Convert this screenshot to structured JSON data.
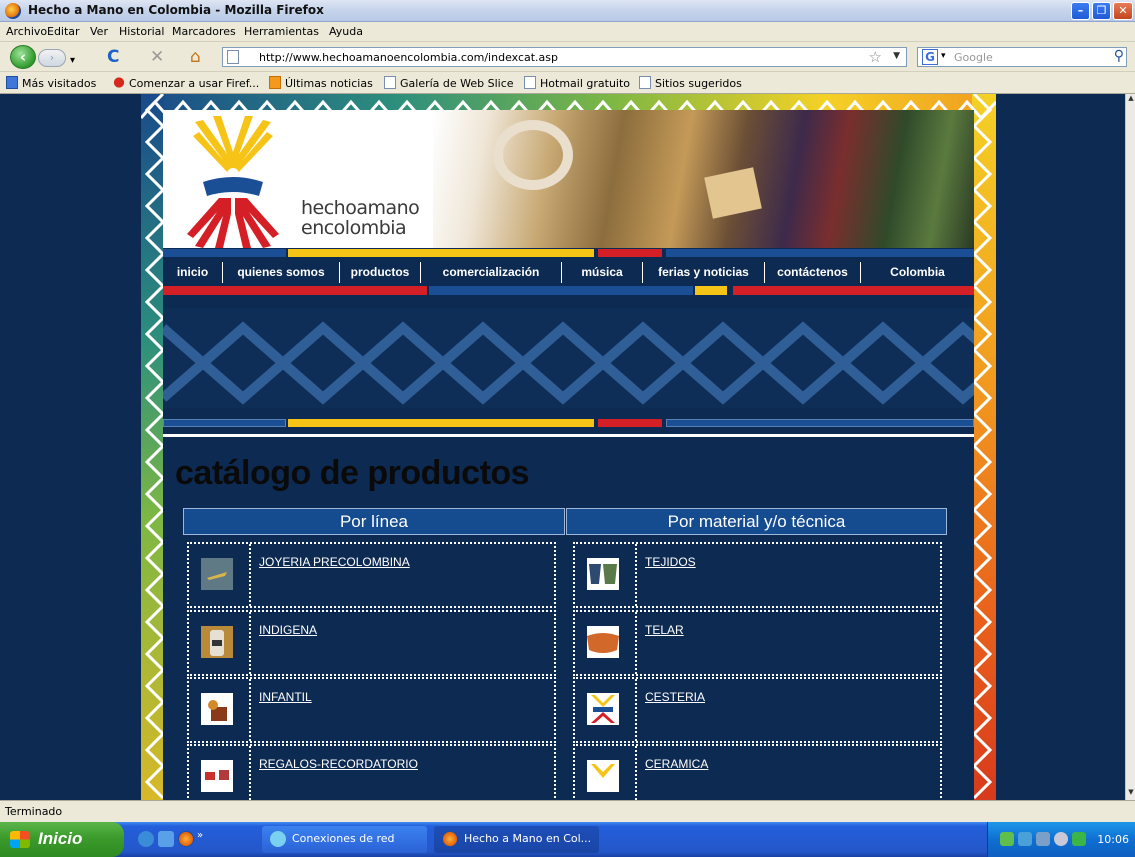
{
  "window": {
    "title": "Hecho a Mano en Colombia - Mozilla Firefox"
  },
  "menu": [
    "Archivo",
    "Editar",
    "Ver",
    "Historial",
    "Marcadores",
    "Herramientas",
    "Ayuda"
  ],
  "address": {
    "url": "http://www.hechoamanoencolombia.com/indexcat.asp"
  },
  "search": {
    "placeholder": "Google"
  },
  "bookmarks": [
    "Más visitados",
    "Comenzar a usar Firef...",
    "Últimas noticias",
    "Galería de Web Slice",
    "Hotmail gratuito",
    "Sitios sugeridos"
  ],
  "site": {
    "brand_line1": "hechoamano",
    "brand_line2": "encolombia",
    "nav": [
      "inicio",
      "quienes somos",
      "productos",
      "comercialización",
      "música",
      "ferias y noticias",
      "contáctenos",
      "Colombia"
    ],
    "page_title": "catálogo de productos",
    "catalog": {
      "col_left_header": "Por línea",
      "col_right_header": "Por material y/o técnica",
      "left": [
        "JOYERIA PRECOLOMBINA",
        "INDIGENA",
        "INFANTIL",
        "REGALOS-RECORDATORIO"
      ],
      "right": [
        "TEJIDOS",
        "TELAR",
        "CESTERIA",
        "CERAMICA"
      ]
    }
  },
  "status": {
    "text": "Terminado"
  },
  "taskbar": {
    "start": "Inicio",
    "tasks": [
      "Conexiones de red",
      "Hecho a Mano en Col..."
    ],
    "clock": "10:06"
  },
  "colors": {
    "site_navy": "#0d2a52",
    "flag_yellow": "#f6c416",
    "flag_blue": "#1b4f95",
    "flag_red": "#d51f26"
  }
}
